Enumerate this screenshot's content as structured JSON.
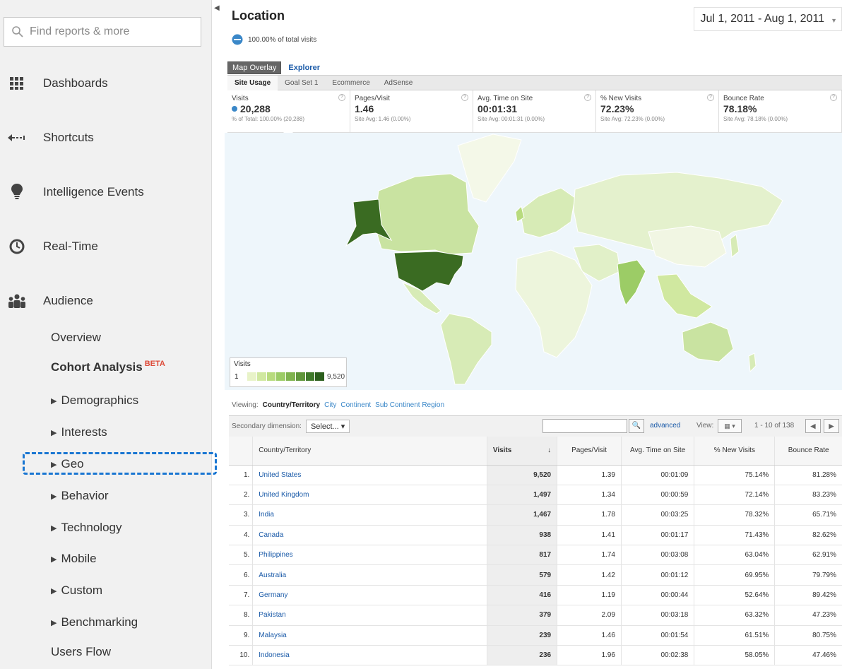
{
  "sidebar": {
    "search_placeholder": "Find reports & more",
    "nav": [
      {
        "label": "Dashboards",
        "icon": "grid-icon"
      },
      {
        "label": "Shortcuts",
        "icon": "shortcut-arrow-icon"
      },
      {
        "label": "Intelligence Events",
        "icon": "lightbulb-icon"
      },
      {
        "label": "Real-Time",
        "icon": "clock-icon"
      },
      {
        "label": "Audience",
        "icon": "people-icon"
      }
    ],
    "audience_items": {
      "overview": "Overview",
      "cohort": "Cohort Analysis",
      "cohort_badge": "BETA",
      "demographics": "Demographics",
      "interests": "Interests",
      "geo": "Geo",
      "behavior": "Behavior",
      "technology": "Technology",
      "mobile": "Mobile",
      "custom": "Custom",
      "benchmarking": "Benchmarking",
      "users_flow": "Users Flow"
    }
  },
  "header": {
    "title": "Location",
    "total_visits": "100.00% of total visits",
    "date_range": "Jul 1, 2011 - Aug 1, 2011"
  },
  "view_tabs": {
    "active": "Map Overlay",
    "other": "Explorer"
  },
  "metric_tabs": [
    "Site Usage",
    "Goal Set 1",
    "Ecommerce",
    "AdSense"
  ],
  "scorecards": [
    {
      "label": "Visits",
      "value": "20,288",
      "sub": "% of Total: 100.00% (20,288)"
    },
    {
      "label": "Pages/Visit",
      "value": "1.46",
      "sub": "Site Avg: 1.46 (0.00%)"
    },
    {
      "label": "Avg. Time on Site",
      "value": "00:01:31",
      "sub": "Site Avg: 00:01:31 (0.00%)"
    },
    {
      "label": "% New Visits",
      "value": "72.23%",
      "sub": "Site Avg: 72.23% (0.00%)"
    },
    {
      "label": "Bounce Rate",
      "value": "78.18%",
      "sub": "Site Avg: 78.18% (0.00%)"
    }
  ],
  "legend": {
    "title": "Visits",
    "min": "1",
    "max": "9,520",
    "colors": [
      "#e8f3c8",
      "#d0e8a0",
      "#b8db7e",
      "#9ccc66",
      "#7fb34e",
      "#5f963a",
      "#3f7a2a",
      "#2b5e1c"
    ]
  },
  "map_colors": {
    "ocean": "#eef6fb",
    "low": "#e8f3d0",
    "mid": "#c9e3a1",
    "high": "#3f7a2a",
    "top": "#3a6b22",
    "greenland": "#f4f8e8"
  },
  "viewing": {
    "label": "Viewing:",
    "active": "Country/Territory",
    "options": [
      "City",
      "Continent",
      "Sub Continent Region"
    ]
  },
  "controls": {
    "secondary_label": "Secondary dimension:",
    "select_value": "Select...",
    "advanced": "advanced",
    "view_label": "View:",
    "pager": "1 - 10 of 138"
  },
  "table": {
    "headers": [
      "Country/Territory",
      "Visits",
      "Pages/Visit",
      "Avg. Time on Site",
      "% New Visits",
      "Bounce Rate"
    ],
    "rows": [
      {
        "idx": "1.",
        "country": "United States",
        "visits": "9,520",
        "pages": "1.39",
        "time": "00:01:09",
        "new": "75.14%",
        "bounce": "81.28%"
      },
      {
        "idx": "2.",
        "country": "United Kingdom",
        "visits": "1,497",
        "pages": "1.34",
        "time": "00:00:59",
        "new": "72.14%",
        "bounce": "83.23%"
      },
      {
        "idx": "3.",
        "country": "India",
        "visits": "1,467",
        "pages": "1.78",
        "time": "00:03:25",
        "new": "78.32%",
        "bounce": "65.71%"
      },
      {
        "idx": "4.",
        "country": "Canada",
        "visits": "938",
        "pages": "1.41",
        "time": "00:01:17",
        "new": "71.43%",
        "bounce": "82.62%"
      },
      {
        "idx": "5.",
        "country": "Philippines",
        "visits": "817",
        "pages": "1.74",
        "time": "00:03:08",
        "new": "63.04%",
        "bounce": "62.91%"
      },
      {
        "idx": "6.",
        "country": "Australia",
        "visits": "579",
        "pages": "1.42",
        "time": "00:01:12",
        "new": "69.95%",
        "bounce": "79.79%"
      },
      {
        "idx": "7.",
        "country": "Germany",
        "visits": "416",
        "pages": "1.19",
        "time": "00:00:44",
        "new": "52.64%",
        "bounce": "89.42%"
      },
      {
        "idx": "8.",
        "country": "Pakistan",
        "visits": "379",
        "pages": "2.09",
        "time": "00:03:18",
        "new": "63.32%",
        "bounce": "47.23%"
      },
      {
        "idx": "9.",
        "country": "Malaysia",
        "visits": "239",
        "pages": "1.46",
        "time": "00:01:54",
        "new": "61.51%",
        "bounce": "80.75%"
      },
      {
        "idx": "10.",
        "country": "Indonesia",
        "visits": "236",
        "pages": "1.96",
        "time": "00:02:38",
        "new": "58.05%",
        "bounce": "47.46%"
      }
    ]
  }
}
